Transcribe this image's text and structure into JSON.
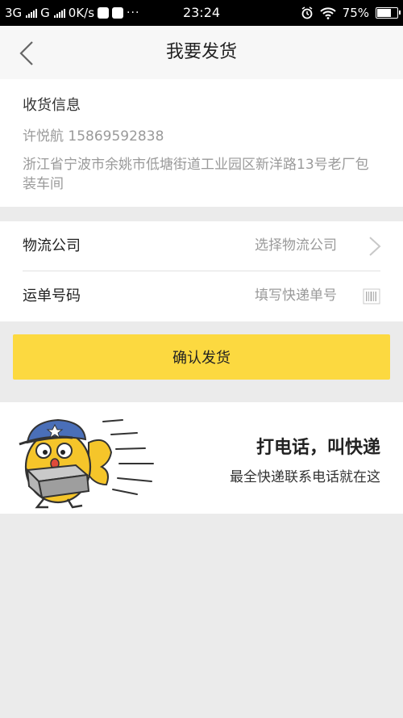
{
  "status_bar": {
    "network_1": "3G",
    "network_2": "G",
    "speed": "0K/s",
    "dots": "···",
    "time": "23:24",
    "battery": "75%",
    "battery_level": 0.75
  },
  "header": {
    "title": "我要发货"
  },
  "shipping_info": {
    "title": "收货信息",
    "name_phone": "许悦航 15869592838",
    "address": "浙江省宁波市余姚市低塘街道工业园区新洋路13号老厂包装车间"
  },
  "form": {
    "company_label": "物流公司",
    "company_placeholder": "选择物流公司",
    "tracking_label": "运单号码",
    "tracking_placeholder": "填写快递单号"
  },
  "confirm_button": "确认发货",
  "banner": {
    "title": "打电话，叫快递",
    "subtitle": "最全快递联系电话就在这"
  },
  "colors": {
    "accent": "#fcd940",
    "mascot_body": "#f5c52a",
    "mascot_hat": "#4a6fb8"
  }
}
